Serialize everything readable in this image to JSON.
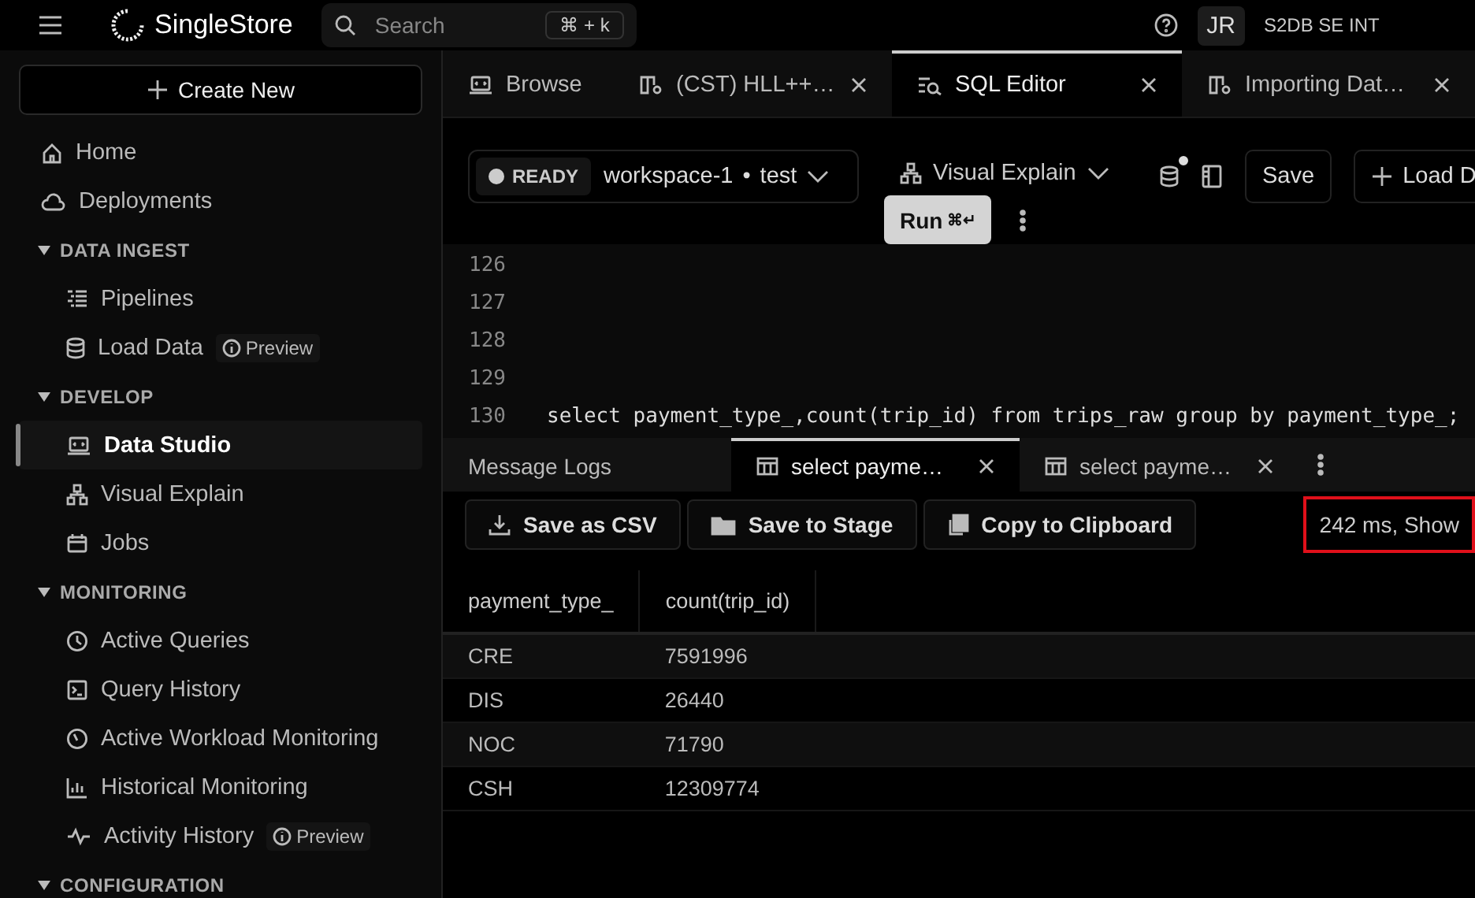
{
  "top_bar": {
    "logo": "SingleStore",
    "search": {
      "placeholder": "Search",
      "shortcut": "⌘ + k"
    },
    "avatar": "JR",
    "org": "S2DB SE INT"
  },
  "sidebar": {
    "create_button": "Create New",
    "links": [
      {
        "label": "Home",
        "selected": false
      },
      {
        "label": "Deployments",
        "selected": false
      }
    ],
    "sections": [
      {
        "title": "DATA INGEST",
        "expanded": true,
        "items": [
          {
            "label": "Pipelines",
            "selected": false
          },
          {
            "label": "Load Data",
            "badge": "Preview",
            "selected": false
          }
        ]
      },
      {
        "title": "DEVELOP",
        "expanded": true,
        "items": [
          {
            "label": "Data Studio",
            "selected": true
          },
          {
            "label": "Visual Explain",
            "selected": false
          },
          {
            "label": "Jobs",
            "selected": false
          }
        ]
      },
      {
        "title": "MONITORING",
        "expanded": true,
        "items": [
          {
            "label": "Active Queries",
            "selected": false
          },
          {
            "label": "Query History",
            "selected": false
          },
          {
            "label": "Active Workload Monitoring",
            "selected": false
          },
          {
            "label": "Historical Monitoring",
            "selected": false
          },
          {
            "label": "Activity History",
            "badge": "Preview",
            "selected": false
          }
        ]
      },
      {
        "title": "CONFIGURATION",
        "expanded": true
      }
    ]
  },
  "tabs": [
    {
      "label": "Browse",
      "selected": false,
      "closable": false
    },
    {
      "label": "(CST) HLL++…",
      "selected": false,
      "closable": true
    },
    {
      "label": "SQL Editor",
      "selected": true,
      "closable": true
    },
    {
      "label": "Importing Dat…",
      "selected": false,
      "closable": true
    }
  ],
  "toolbar": {
    "status": "READY",
    "workspace": "workspace-1",
    "separator": "•",
    "database": "test",
    "visual_explain": "Visual Explain",
    "save": "Save",
    "load": "Load D",
    "run": "Run",
    "run_shortcut": "⌘↵"
  },
  "editor": {
    "lines": [
      {
        "number": "126"
      },
      {
        "number": "127"
      },
      {
        "number": "128"
      },
      {
        "number": "129"
      },
      {
        "number": "130",
        "code": "select payment_type_,count(trip_id) from trips_raw group by payment_type_;"
      }
    ]
  },
  "result_tabs": [
    {
      "label": "Message Logs",
      "selected": false,
      "closable": false
    },
    {
      "label": "select payme…",
      "selected": true,
      "closable": true
    },
    {
      "label": "select payme…",
      "selected": false,
      "closable": true
    }
  ],
  "result_actions": [
    {
      "label": "Save as CSV"
    },
    {
      "label": "Save to Stage"
    },
    {
      "label": "Copy to Clipboard"
    }
  ],
  "stats": {
    "text": "242 ms, Show",
    "highlighted": true
  },
  "table": {
    "columns": [
      "payment_type_",
      "count(trip_id)"
    ],
    "rows": [
      [
        "CRE",
        "7591996"
      ],
      [
        "DIS",
        "26440"
      ],
      [
        "NOC",
        "71790"
      ],
      [
        "CSH",
        "12309774"
      ]
    ]
  }
}
